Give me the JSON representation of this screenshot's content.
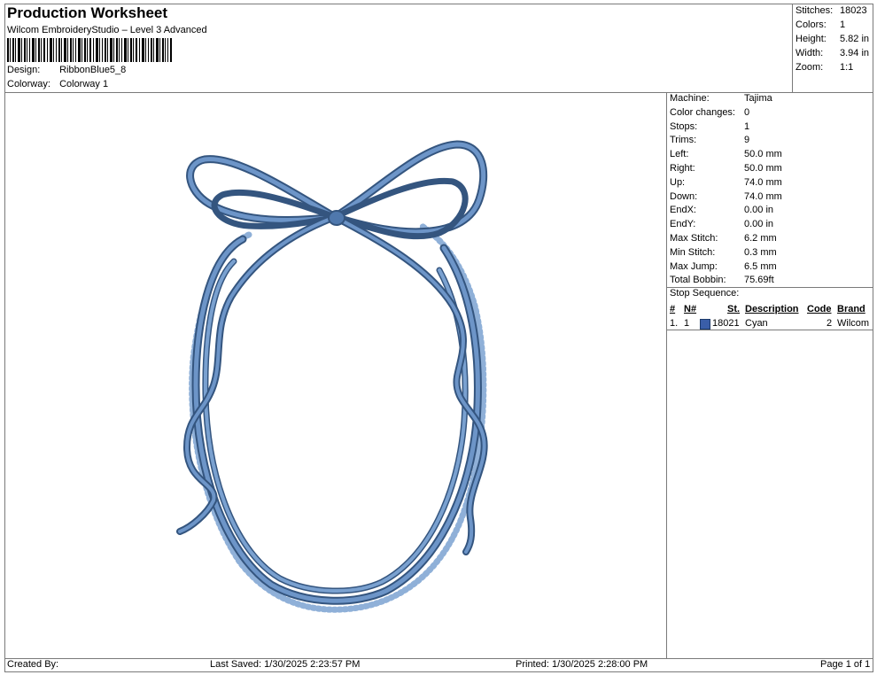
{
  "header": {
    "title": "Production Worksheet",
    "subtitle": "Wilcom EmbroideryStudio – Level 3 Advanced",
    "design_label": "Design:",
    "design_value": "RibbonBlue5_8",
    "colorway_label": "Colorway:",
    "colorway_value": "Colorway 1"
  },
  "stats": [
    {
      "label": "Stitches:",
      "value": "18023"
    },
    {
      "label": "Colors:",
      "value": "1"
    },
    {
      "label": "Height:",
      "value": "5.82 in"
    },
    {
      "label": "Width:",
      "value": "3.94 in"
    },
    {
      "label": "Zoom:",
      "value": "1:1"
    }
  ],
  "machine_info": [
    {
      "label": "Machine:",
      "value": "Tajima"
    },
    {
      "label": "Color changes:",
      "value": "0"
    },
    {
      "label": "Stops:",
      "value": "1"
    },
    {
      "label": "Trims:",
      "value": "9"
    },
    {
      "label": "Left:",
      "value": "50.0 mm"
    },
    {
      "label": "Right:",
      "value": "50.0 mm"
    },
    {
      "label": "Up:",
      "value": "74.0 mm"
    },
    {
      "label": "Down:",
      "value": "74.0 mm"
    },
    {
      "label": "EndX:",
      "value": "0.00 in"
    },
    {
      "label": "EndY:",
      "value": "0.00 in"
    },
    {
      "label": "Max Stitch:",
      "value": "6.2 mm"
    },
    {
      "label": "Min Stitch:",
      "value": "0.3 mm"
    },
    {
      "label": "Max Jump:",
      "value": "6.5 mm"
    },
    {
      "label": "Total Bobbin:",
      "value": "75.69ft"
    }
  ],
  "stop_sequence": {
    "title": "Stop Sequence:",
    "headers": {
      "num": "#",
      "n": "N#",
      "st": "St.",
      "description": "Description",
      "code": "Code",
      "brand": "Brand"
    },
    "rows": [
      {
        "num": "1.",
        "n": "1",
        "color": "#3a5ea8",
        "st": "18021",
        "description": "Cyan",
        "code": "2",
        "brand": "Wilcom"
      }
    ]
  },
  "footer": {
    "created_by": "Created By:",
    "last_saved": "Last Saved: 1/30/2025 2:23:57 PM",
    "printed": "Printed: 1/30/2025 2:28:00 PM",
    "page": "Page 1 of 1"
  },
  "colors": {
    "thread": "#5b84b8",
    "thread_dark": "#34557f",
    "thread_light": "#8fb0d8"
  }
}
